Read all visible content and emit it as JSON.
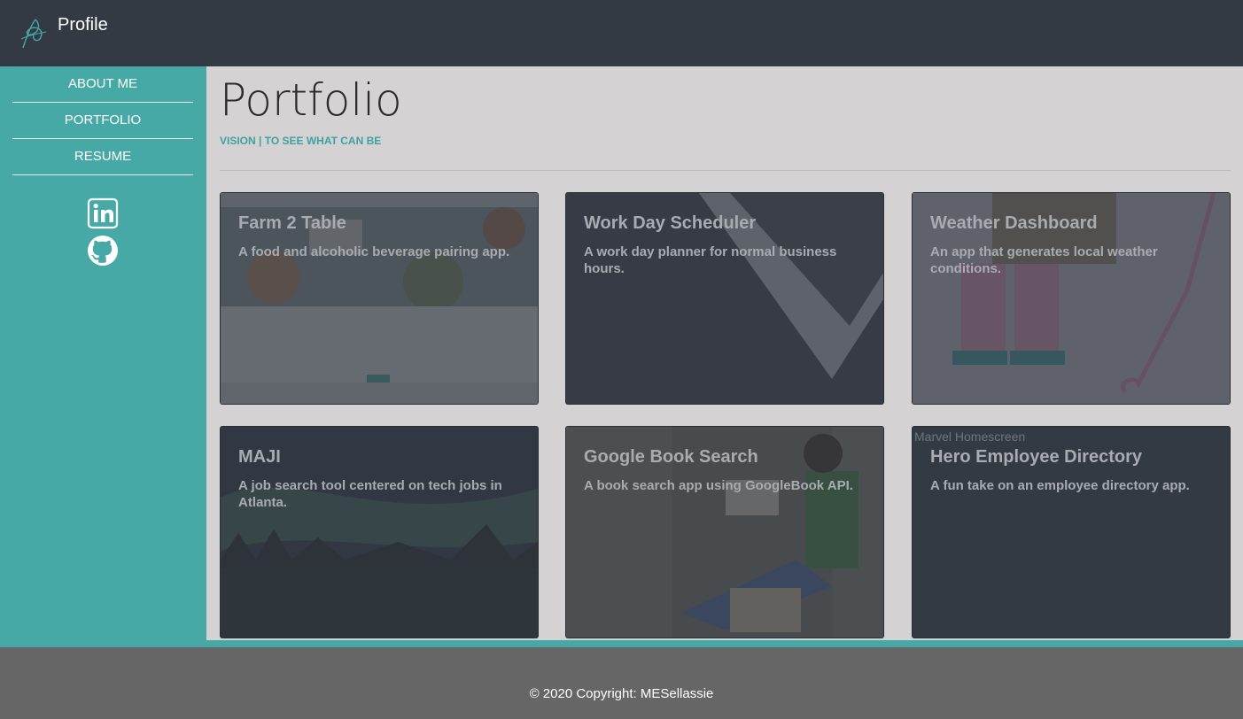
{
  "header": {
    "brand": "Profile"
  },
  "sidebar": {
    "items": [
      {
        "label": "ABOUT ME"
      },
      {
        "label": "PORTFOLIO"
      },
      {
        "label": "RESUME"
      }
    ],
    "social": [
      "linkedin-icon",
      "github-icon"
    ]
  },
  "main": {
    "title": "Portfolio",
    "tagline": "VISION | TO SEE WHAT CAN BE"
  },
  "projects": [
    {
      "title": "Farm 2 Table",
      "desc": "A food and alcoholic beverage pairing app."
    },
    {
      "title": "Work Day Scheduler",
      "desc": "A work day planner for normal business hours."
    },
    {
      "title": "Weather Dashboard",
      "desc": "An app that generates local weather conditions."
    },
    {
      "title": "MAJI",
      "desc": "A job search tool centered on tech jobs in Atlanta."
    },
    {
      "title": "Google Book Search",
      "desc": "A book search app using GoogleBook API."
    },
    {
      "title": "Hero Employee Directory",
      "desc": "A fun take on an employee directory app.",
      "broken_image_alt": "Marvel Homescreen"
    }
  ],
  "footer": {
    "text": "© 2020 Copyright: MESellassie"
  },
  "colors": {
    "topbar": "#343a44",
    "accent": "#46a9a6",
    "main_bg": "#d4d2d3",
    "footer": "#666666"
  }
}
